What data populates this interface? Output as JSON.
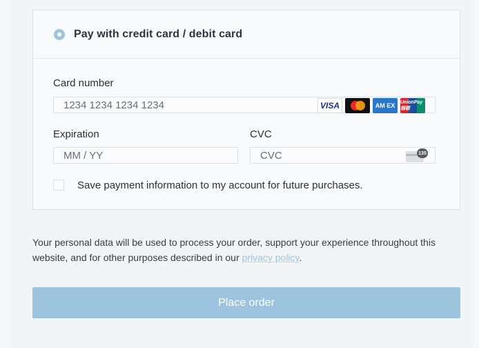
{
  "payment": {
    "method_label": "Pay with credit card / debit card",
    "card_number": {
      "label": "Card number",
      "placeholder": "1234 1234 1234 1234"
    },
    "card_brands": {
      "visa": "VISA",
      "amex": "AM EX",
      "unionpay": "UnionPay 银联"
    },
    "expiration": {
      "label": "Expiration",
      "placeholder": "MM / YY"
    },
    "cvc": {
      "label": "CVC",
      "placeholder": "CVC",
      "icon_badge": "135"
    },
    "save_info_label": "Save payment information to my account for future purchases."
  },
  "privacy": {
    "text_before": "Your personal data will be used to process your order, support your experience throughout this website, and for other purposes described in our ",
    "link_text": "privacy policy",
    "text_after": "."
  },
  "actions": {
    "place_order_label": "Place order"
  },
  "colors": {
    "accent": "#9cc4de",
    "border": "#dfe3e8"
  },
  "icons": {
    "radio": "radio-selected-icon",
    "visa": "visa-logo-icon",
    "mastercard": "mastercard-logo-icon",
    "amex": "amex-logo-icon",
    "unionpay": "unionpay-logo-icon",
    "cvc": "cvc-card-icon"
  }
}
